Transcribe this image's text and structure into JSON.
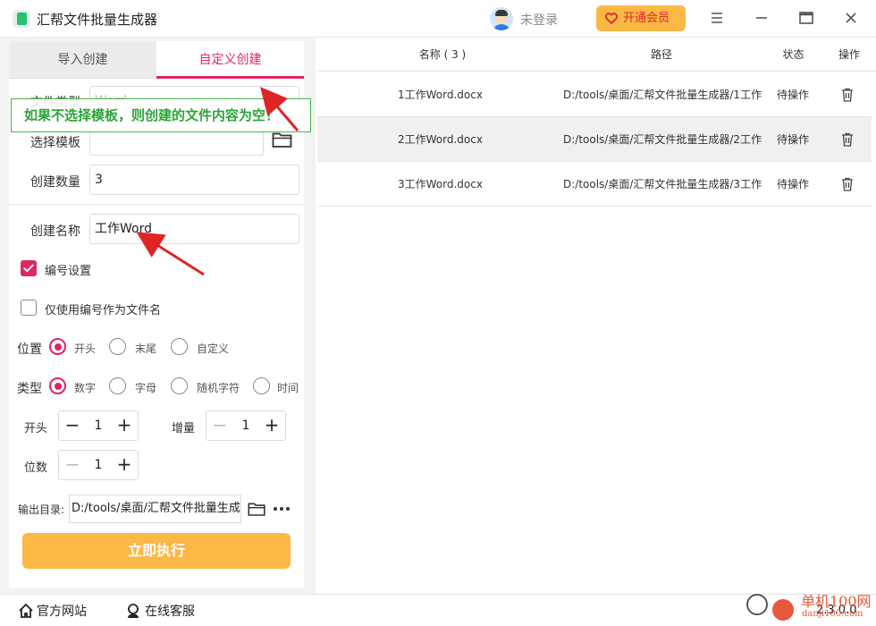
{
  "app": {
    "title": "汇帮文件批量生成器",
    "login": "未登录",
    "vip": "开通会员"
  },
  "tabs": {
    "import": "导入创建",
    "custom": "自定义创建"
  },
  "form": {
    "file_type_label": "文件类型",
    "file_type_value": "Word",
    "hint": "如果不选择模板，则创建的文件内容为空！",
    "template_label": "选择模板",
    "template_value": "",
    "count_label": "创建数量",
    "count_value": "3",
    "name_label": "创建名称",
    "name_value": "工作Word",
    "numbering_setting": "编号设置",
    "numbering_setting_checked": true,
    "only_number": "仅使用编号作为文件名",
    "only_number_checked": false,
    "position_label": "位置",
    "position_options": [
      "开头",
      "末尾",
      "自定义"
    ],
    "position_selected": "开头",
    "type_label": "类型",
    "type_options": [
      "数字",
      "字母",
      "随机字符",
      "时间"
    ],
    "type_selected": "数字",
    "start_label": "开头",
    "start_value": "1",
    "increment_label": "增量",
    "increment_value": "1",
    "digits_label": "位数",
    "digits_value": "1",
    "output_label": "输出目录:",
    "output_value": "D:/tools/桌面/汇帮文件批量生成器",
    "run": "立即执行"
  },
  "table": {
    "headers": {
      "name": "名称 ( 3 )",
      "path": "路径",
      "status": "状态",
      "action": "操作"
    },
    "rows": [
      {
        "name": "1工作Word.docx",
        "path": "D:/tools/桌面/汇帮文件批量生成器/1工作",
        "status": "待操作"
      },
      {
        "name": "2工作Word.docx",
        "path": "D:/tools/桌面/汇帮文件批量生成器/2工作",
        "status": "待操作"
      },
      {
        "name": "3工作Word.docx",
        "path": "D:/tools/桌面/汇帮文件批量生成器/3工作",
        "status": "待操作"
      }
    ]
  },
  "footer": {
    "website": "官方网站",
    "service": "在线客服",
    "version": "2.3.0.0"
  },
  "watermark": {
    "cn": "单机100网",
    "en": "danji100.com"
  },
  "colors": {
    "accent": "#e0265f",
    "button": "#fbb844",
    "hint_green": "#2da43a",
    "annotation_red": "#e02424"
  },
  "icons": [
    "menu-icon",
    "minimize-icon",
    "maximize-icon",
    "close-icon",
    "folder-icon",
    "trash-icon",
    "home-icon",
    "support-icon",
    "more-icon",
    "heart-icon"
  ]
}
